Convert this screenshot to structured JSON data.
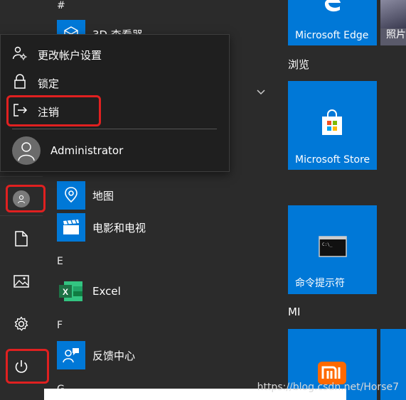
{
  "popup": {
    "items": [
      {
        "label": "更改帐户设置",
        "icon": "account-settings-icon"
      },
      {
        "label": "锁定",
        "icon": "lock-icon"
      },
      {
        "label": "注销",
        "icon": "sign-out-icon"
      }
    ],
    "user": {
      "name": "Administrator"
    }
  },
  "applist": {
    "letters": {
      "hash": "#",
      "e": "E",
      "f": "F",
      "g": "G"
    },
    "apps": {
      "viewer3d": "3D 查看器",
      "maps": "地图",
      "movies": "电影和电视",
      "excel": "Excel",
      "feedback": "反馈中心"
    }
  },
  "tiles": {
    "edge": "Microsoft Edge",
    "photos": "照片",
    "browse_group": "浏览",
    "store": "Microsoft Store",
    "cmd": "命令提示符",
    "mi_group": "MI"
  },
  "watermark": "https://blog.csdn.net/Horse7",
  "colors": {
    "tile_blue": "#0078d7",
    "highlight_red": "#e02020",
    "excel_green": "#1e7145"
  }
}
